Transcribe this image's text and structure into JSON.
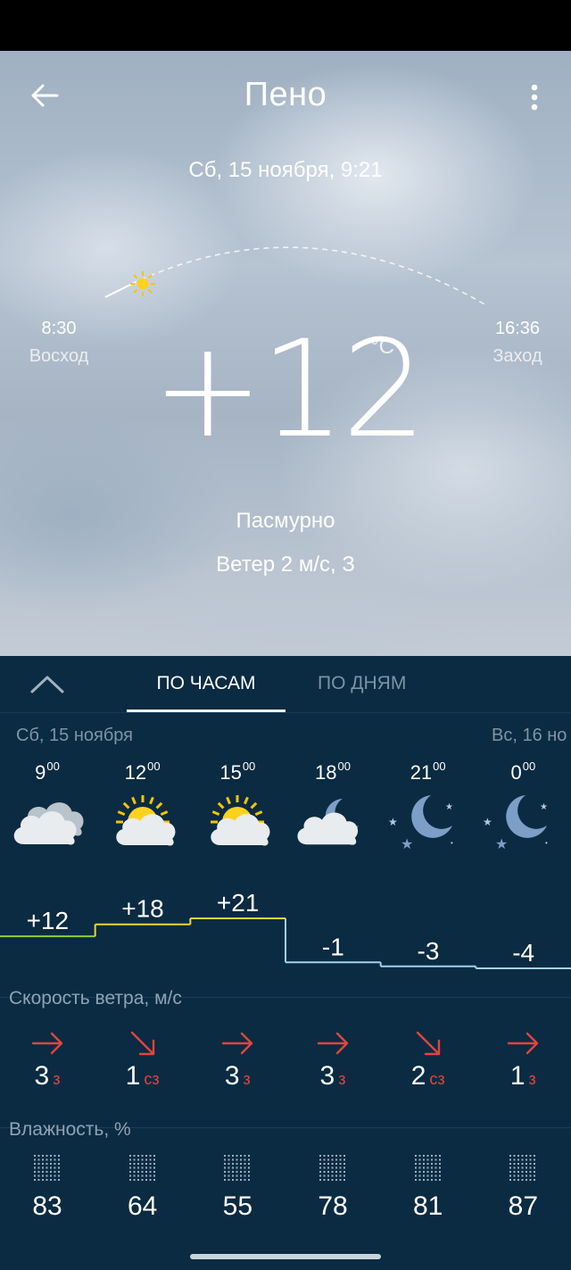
{
  "header": {
    "city": "Пено",
    "datetime": "Сб, 15 ноября, 9:21"
  },
  "sun": {
    "sunrise_time": "8:30",
    "sunrise_label": "Восход",
    "sunset_time": "16:36",
    "sunset_label": "Заход",
    "progress": 0.1
  },
  "current": {
    "temperature": "+12",
    "unit": "°C",
    "condition": "Пасмурно",
    "wind": "Ветер 2 м/с, З"
  },
  "tabs": {
    "hourly": "ПО ЧАСАМ",
    "daily": "ПО ДНЯМ"
  },
  "days": {
    "today": "Сб, 15 ноября",
    "tomorrow": "Вс, 16 но"
  },
  "hours": [
    {
      "h": "9",
      "m": "00",
      "icon": "cloudy-icon",
      "temp": "+12",
      "wind_speed": "3",
      "wind_dir": "з",
      "wind_arrow": "arrow-east-icon",
      "humidity": "83"
    },
    {
      "h": "12",
      "m": "00",
      "icon": "partly-sunny-icon",
      "temp": "+18",
      "wind_speed": "1",
      "wind_dir": "сз",
      "wind_arrow": "arrow-southeast-icon",
      "humidity": "64"
    },
    {
      "h": "15",
      "m": "00",
      "icon": "partly-sunny-icon",
      "temp": "+21",
      "wind_speed": "3",
      "wind_dir": "з",
      "wind_arrow": "arrow-east-icon",
      "humidity": "55"
    },
    {
      "h": "18",
      "m": "00",
      "icon": "night-cloudy-icon",
      "temp": "-1",
      "wind_speed": "3",
      "wind_dir": "з",
      "wind_arrow": "arrow-east-icon",
      "humidity": "78"
    },
    {
      "h": "21",
      "m": "00",
      "icon": "clear-night-icon",
      "temp": "-3",
      "wind_speed": "2",
      "wind_dir": "сз",
      "wind_arrow": "arrow-southeast-icon",
      "humidity": "81"
    },
    {
      "h": "0",
      "m": "00",
      "icon": "clear-night-icon",
      "temp": "-4",
      "wind_speed": "1",
      "wind_dir": "з",
      "wind_arrow": "arrow-east-icon",
      "humidity": "87"
    }
  ],
  "sections": {
    "wind": "Скорость ветра, м/с",
    "humidity": "Влажность, %"
  },
  "colors": {
    "panel_bg": "#0b2b42",
    "wind_arrow": "#e0453f",
    "temp_warm": "#f2d33b",
    "temp_mild": "#8fcf3a",
    "temp_cold": "#9fd4ef"
  }
}
